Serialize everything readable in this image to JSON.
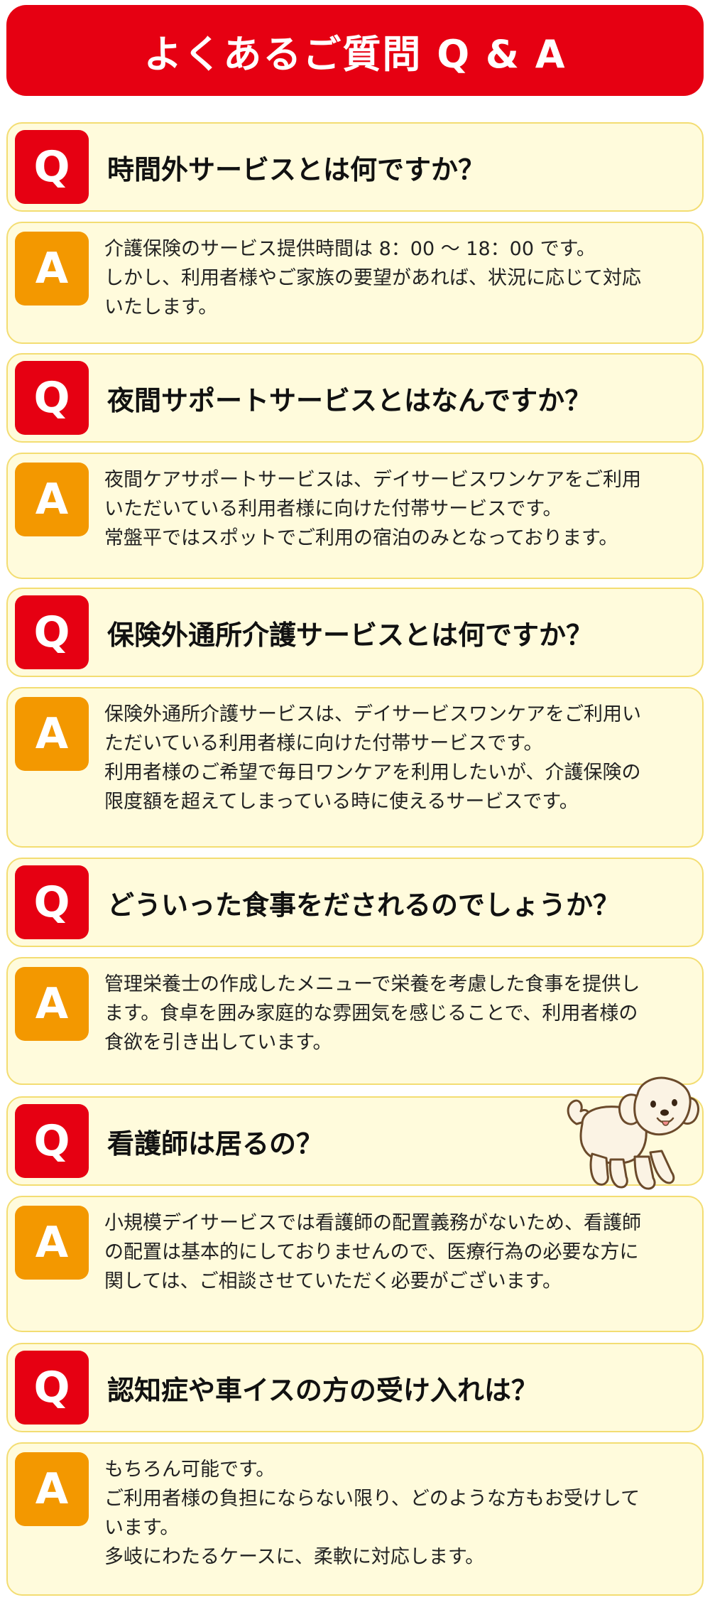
{
  "title": "よくあるご質問 Q & A",
  "q_badge": "Q",
  "a_badge": "A",
  "colors": {
    "red": "#e60012",
    "orange": "#f39800",
    "card_bg": "#fffbdc",
    "card_border": "#f3dd72"
  },
  "qa": [
    {
      "question": "時間外サービスとは何ですか？",
      "answer": [
        "介護保険のサービス提供時間は 8：00 ～ 18：00 です。",
        "しかし、利用者様やご家族の要望があれば、状況に応じて対応",
        "いたします。"
      ]
    },
    {
      "question": "夜間サポートサービスとはなんですか？",
      "answer": [
        "夜間ケアサポートサービスは、デイサービスワンケアをご利用",
        "いただいている利用者様に向けた付帯サービスです。",
        "常盤平ではスポットでご利用の宿泊のみとなっております。"
      ]
    },
    {
      "question": "保険外通所介護サービスとは何ですか？",
      "answer": [
        "保険外通所介護サービスは、デイサービスワンケアをご利用い",
        "ただいている利用者様に向けた付帯サービスです。",
        "利用者様のご希望で毎日ワンケアを利用したいが、介護保険の",
        "限度額を超えてしまっている時に使えるサービスです。"
      ]
    },
    {
      "question": "どういった食事をだされるのでしょうか？",
      "answer": [
        "管理栄養士の作成したメニューで栄養を考慮した食事を提供し",
        "ます。食卓を囲み家庭的な雰囲気を感じることで、利用者様の",
        "食欲を引き出しています。"
      ]
    },
    {
      "question": "看護師は居るの？",
      "answer": [
        "小規模デイサービスでは看護師の配置義務がないため、看護師",
        "の配置は基本的にしておりませんので、医療行為の必要な方に",
        "関しては、ご相談させていただく必要がございます。"
      ]
    },
    {
      "question": "認知症や車イスの方の受け入れは？",
      "answer": [
        "もちろん可能です。",
        "ご利用者様の負担にならない限り、どのような方もお受けして",
        "います。",
        "多岐にわたるケースに、柔軟に対応します。"
      ]
    }
  ]
}
